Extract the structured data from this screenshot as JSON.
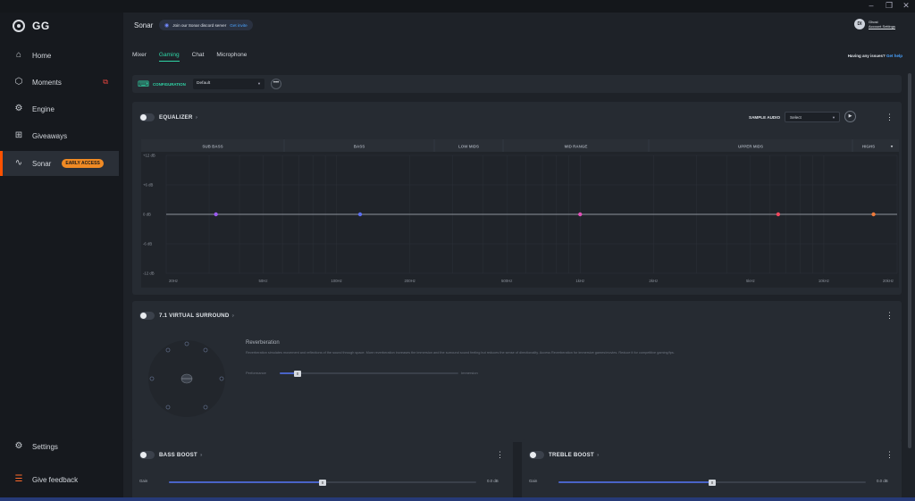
{
  "window": {
    "minimize": "–",
    "maximize": "❐",
    "close": "✕"
  },
  "sidebar": {
    "logo": "GG",
    "items": [
      {
        "label": "Home",
        "icon": "home-icon"
      },
      {
        "label": "Moments",
        "icon": "moments-icon"
      },
      {
        "label": "Engine",
        "icon": "engine-icon"
      },
      {
        "label": "Giveaways",
        "icon": "gift-icon"
      },
      {
        "label": "Sonar",
        "icon": "sonar-icon",
        "badge": "EARLY ACCESS",
        "active": true
      }
    ],
    "settings": "Settings",
    "feedback": "Give feedback"
  },
  "header": {
    "title": "Sonar",
    "discord_text": "Join our Sonar discord server",
    "discord_link": "Get invite",
    "avatar_initials": "DI",
    "account_name": "Ghost",
    "account_link": "Account Settings"
  },
  "tabs": [
    {
      "label": "Mixer"
    },
    {
      "label": "Gaming",
      "active": true
    },
    {
      "label": "Chat"
    },
    {
      "label": "Microphone"
    }
  ],
  "help": {
    "text": "Having any issues?",
    "link": "Get help"
  },
  "config": {
    "label": "CONFIGURATION",
    "value": "Default",
    "menu": "•••"
  },
  "equalizer": {
    "title": "EQUALIZER",
    "help": "?",
    "sample_label": "SAMPLE AUDIO",
    "sample_value": "Select",
    "bands": [
      "SUB BASS",
      "BASS",
      "LOW MIDS",
      "MID RANGE",
      "UPPER MIDS",
      "HIGHS"
    ],
    "y_labels": [
      "+12 dB",
      "+6 dB",
      "0 dB",
      "-6 dB",
      "-12 dB"
    ],
    "x_labels": [
      "20Hz",
      "50Hz",
      "100Hz",
      "200Hz",
      "500Hz",
      "1kHz",
      "2kHz",
      "5kHz",
      "10kHz",
      "20kHz"
    ]
  },
  "chart_data": {
    "type": "line",
    "title": "EQUALIZER",
    "xlabel": "",
    "ylabel": "",
    "x_scale": "log",
    "xlim": [
      20,
      20000
    ],
    "ylim": [
      -12,
      12
    ],
    "series": [
      {
        "values": [
          0,
          0,
          0,
          0,
          0
        ]
      }
    ],
    "points": [
      {
        "freq": 32,
        "gain": 0,
        "color": "#9b5cf0"
      },
      {
        "freq": 125,
        "gain": 0,
        "color": "#5a6ef0"
      },
      {
        "freq": 1000,
        "gain": 0,
        "color": "#e04fb8"
      },
      {
        "freq": 6500,
        "gain": 0,
        "color": "#f0485e"
      },
      {
        "freq": 16000,
        "gain": 0,
        "color": "#f07a3a"
      }
    ],
    "grid": true
  },
  "surround": {
    "title": "7.1 VIRTUAL SURROUND",
    "help": "?",
    "reverb_title": "Reverberation",
    "reverb_desc": "Reverberation simulates movement and reflections of the sound through space. More reverberation increases the immersion and the surround sound feeling but reduces the sense of directionality. Access Reverberation for immersive games/movies. Reduce it for competitive gaming/fps.",
    "left_label": "Performance",
    "right_label": "Immersion",
    "slider_value": 0.1,
    "thumb": "Ⅱ"
  },
  "bass": {
    "title": "BASS BOOST",
    "help": "?",
    "gain_label": "Gain",
    "gain_value": "0.0 dB",
    "level": 0.5,
    "thumb": "Ⅱ"
  },
  "treble": {
    "title": "TREBLE BOOST",
    "help": "?",
    "gain_label": "Gain",
    "gain_value": "0.0 dB",
    "level": 0.5,
    "thumb": "Ⅱ"
  },
  "colors": {
    "accent": "#2fd5a6",
    "sonar_active": "#ff5200",
    "slider": "#4a64c8",
    "link": "#4aa3ff"
  }
}
